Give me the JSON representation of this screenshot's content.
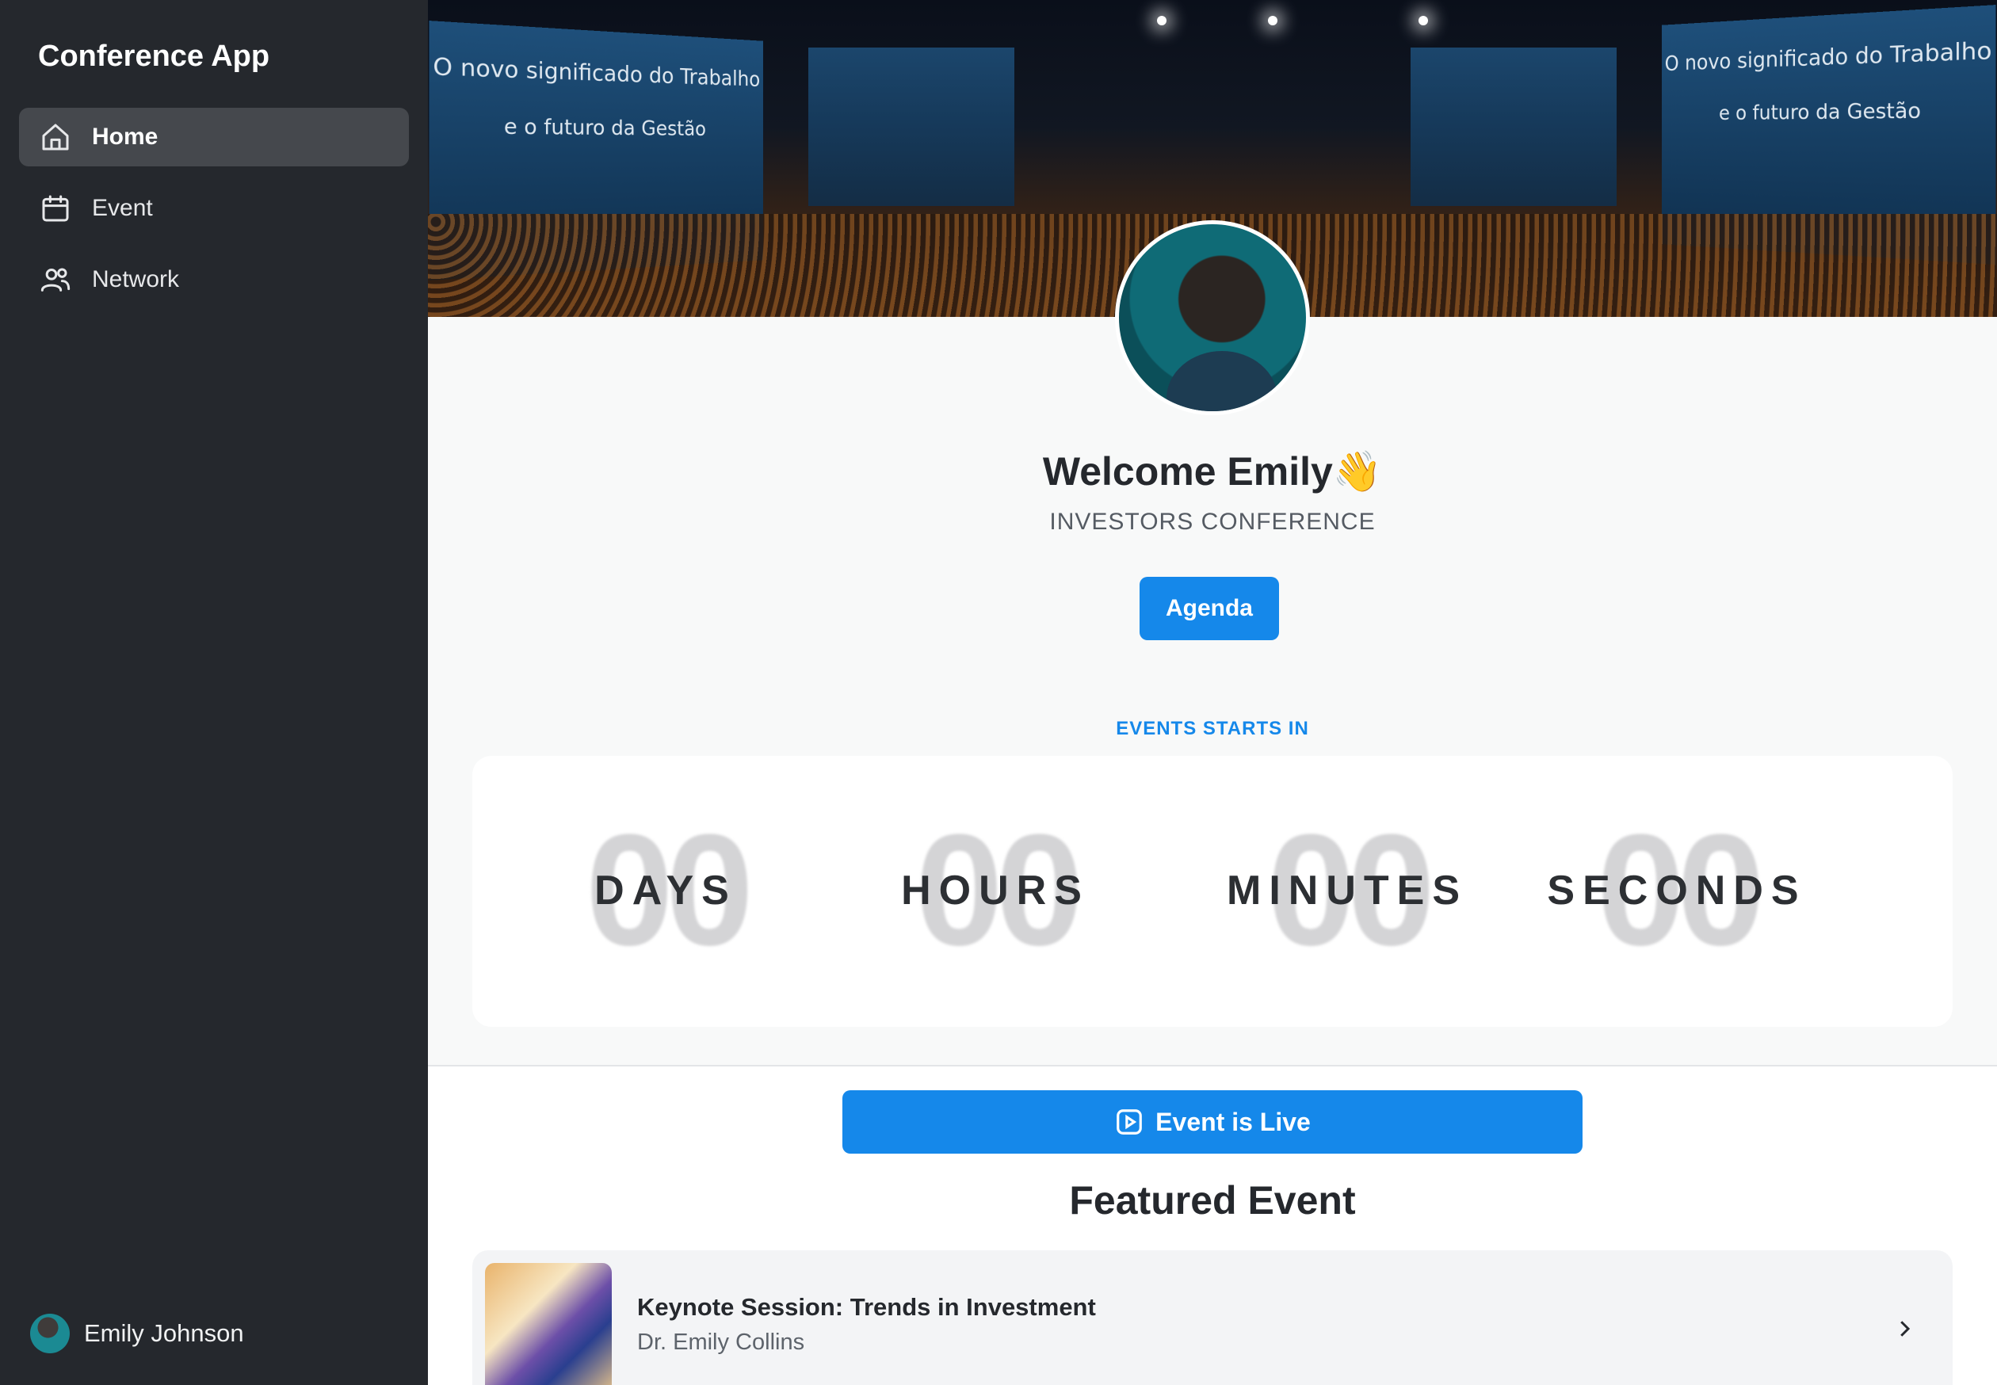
{
  "sidebar": {
    "app_title": "Conference App",
    "items": [
      {
        "label": "Home",
        "icon": "home-icon",
        "active": true
      },
      {
        "label": "Event",
        "icon": "calendar-icon",
        "active": false
      },
      {
        "label": "Network",
        "icon": "users-icon",
        "active": false
      }
    ],
    "user": {
      "name": "Emily Johnson"
    }
  },
  "hero": {
    "banner_text_left_1": "O novo significado do Trabalho",
    "banner_text_left_2": "e o futuro da Gestão",
    "banner_text_right_1": "O novo significado do Trabalho",
    "banner_text_right_2": "e o futuro da Gestão"
  },
  "profile": {
    "welcome": "Welcome Emily👋",
    "conference": "INVESTORS CONFERENCE",
    "agenda_label": "Agenda"
  },
  "countdown": {
    "heading": "EVENTS STARTS IN",
    "units": [
      {
        "value": "00",
        "label": "DAYS"
      },
      {
        "value": "00",
        "label": "HOURS"
      },
      {
        "value": "00",
        "label": "MINUTES"
      },
      {
        "value": "00",
        "label": "SECONDS"
      }
    ]
  },
  "live": {
    "label": "Event is Live"
  },
  "featured": {
    "title": "Featured Event",
    "event": {
      "title": "Keynote Session: Trends in Investment",
      "speaker": "Dr. Emily Collins"
    }
  },
  "colors": {
    "accent": "#1588ea",
    "sidebar_bg": "#25282d",
    "active_item_bg": "#45484d"
  }
}
